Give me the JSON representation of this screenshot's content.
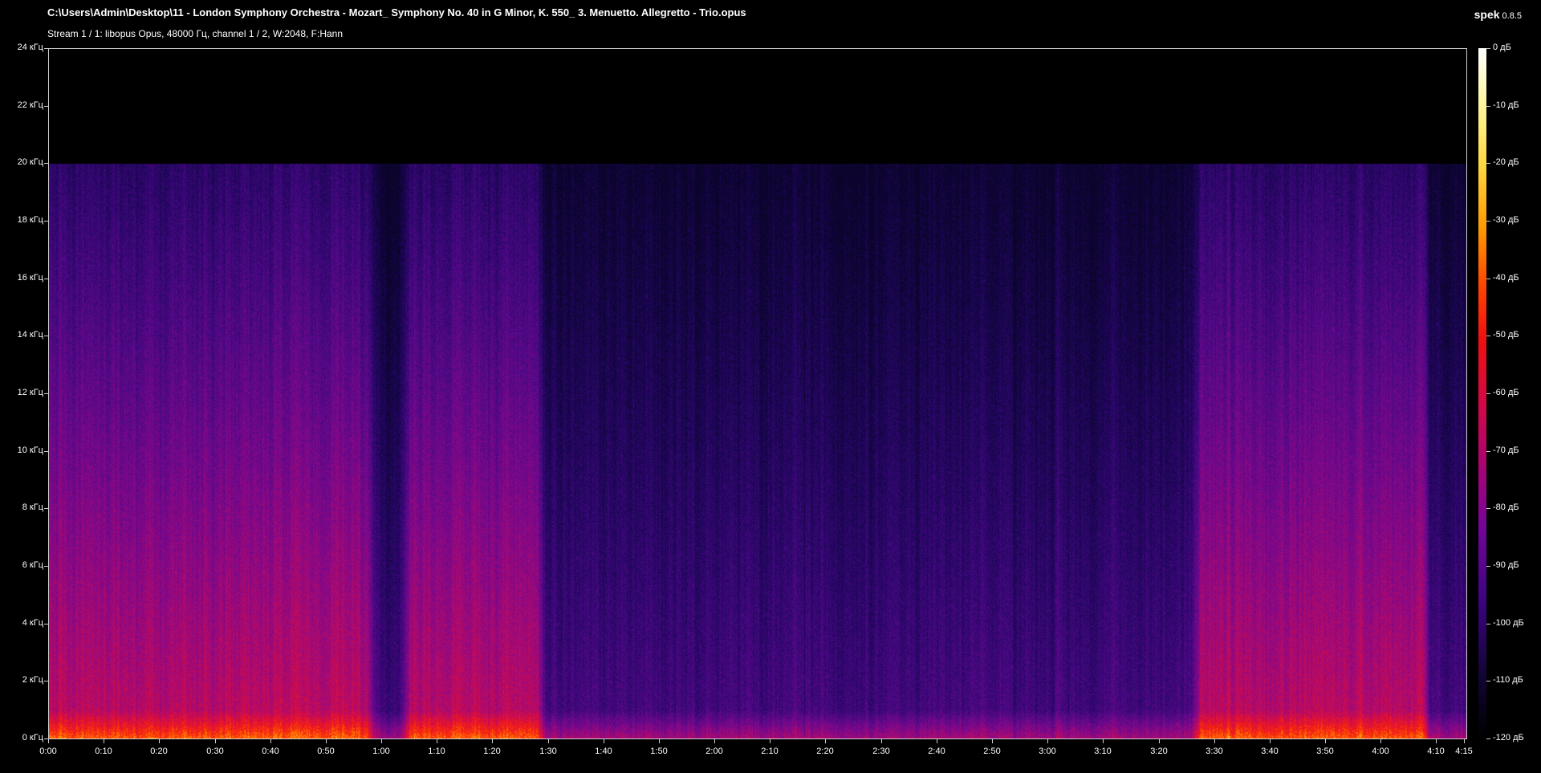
{
  "header": {
    "file_title": "C:\\Users\\Admin\\Desktop\\11 - London Symphony Orchestra - Mozart_ Symphony No. 40 in G Minor, K. 550_ 3. Menuetto. Allegretto - Trio.opus",
    "stream_info": "Stream 1 / 1: libopus Opus, 48000 Гц, channel 1 / 2, W:2048, F:Hann",
    "app_name": "spek",
    "app_version": "0.8.5"
  },
  "spectrogram": {
    "frequency_max_khz": 24,
    "cutoff_khz": 20,
    "duration_seconds": 255,
    "freq_ticks": [
      "24 кГц",
      "22 кГц",
      "20 кГц",
      "18 кГц",
      "16 кГц",
      "14 кГц",
      "12 кГц",
      "10 кГц",
      "8 кГц",
      "6 кГц",
      "4 кГц",
      "2 кГц",
      "0 кГц"
    ],
    "time_ticks": [
      "0:00",
      "0:10",
      "0:20",
      "0:30",
      "0:40",
      "0:50",
      "1:00",
      "1:10",
      "1:20",
      "1:30",
      "1:40",
      "1:50",
      "2:00",
      "2:10",
      "2:20",
      "2:30",
      "2:40",
      "2:50",
      "3:00",
      "3:10",
      "3:20",
      "3:30",
      "3:40",
      "3:50",
      "4:00",
      "4:10",
      "4:15"
    ],
    "loud_segments": [
      {
        "start": "0:00",
        "end": "0:57"
      },
      {
        "start": "1:05",
        "end": "1:28"
      },
      {
        "start": "3:27",
        "end": "4:07"
      }
    ]
  },
  "color_scale": {
    "db_ticks": [
      "0 дБ",
      "-10 дБ",
      "-20 дБ",
      "-30 дБ",
      "-40 дБ",
      "-50 дБ",
      "-60 дБ",
      "-70 дБ",
      "-80 дБ",
      "-90 дБ",
      "-100 дБ",
      "-110 дБ",
      "-120 дБ"
    ]
  }
}
